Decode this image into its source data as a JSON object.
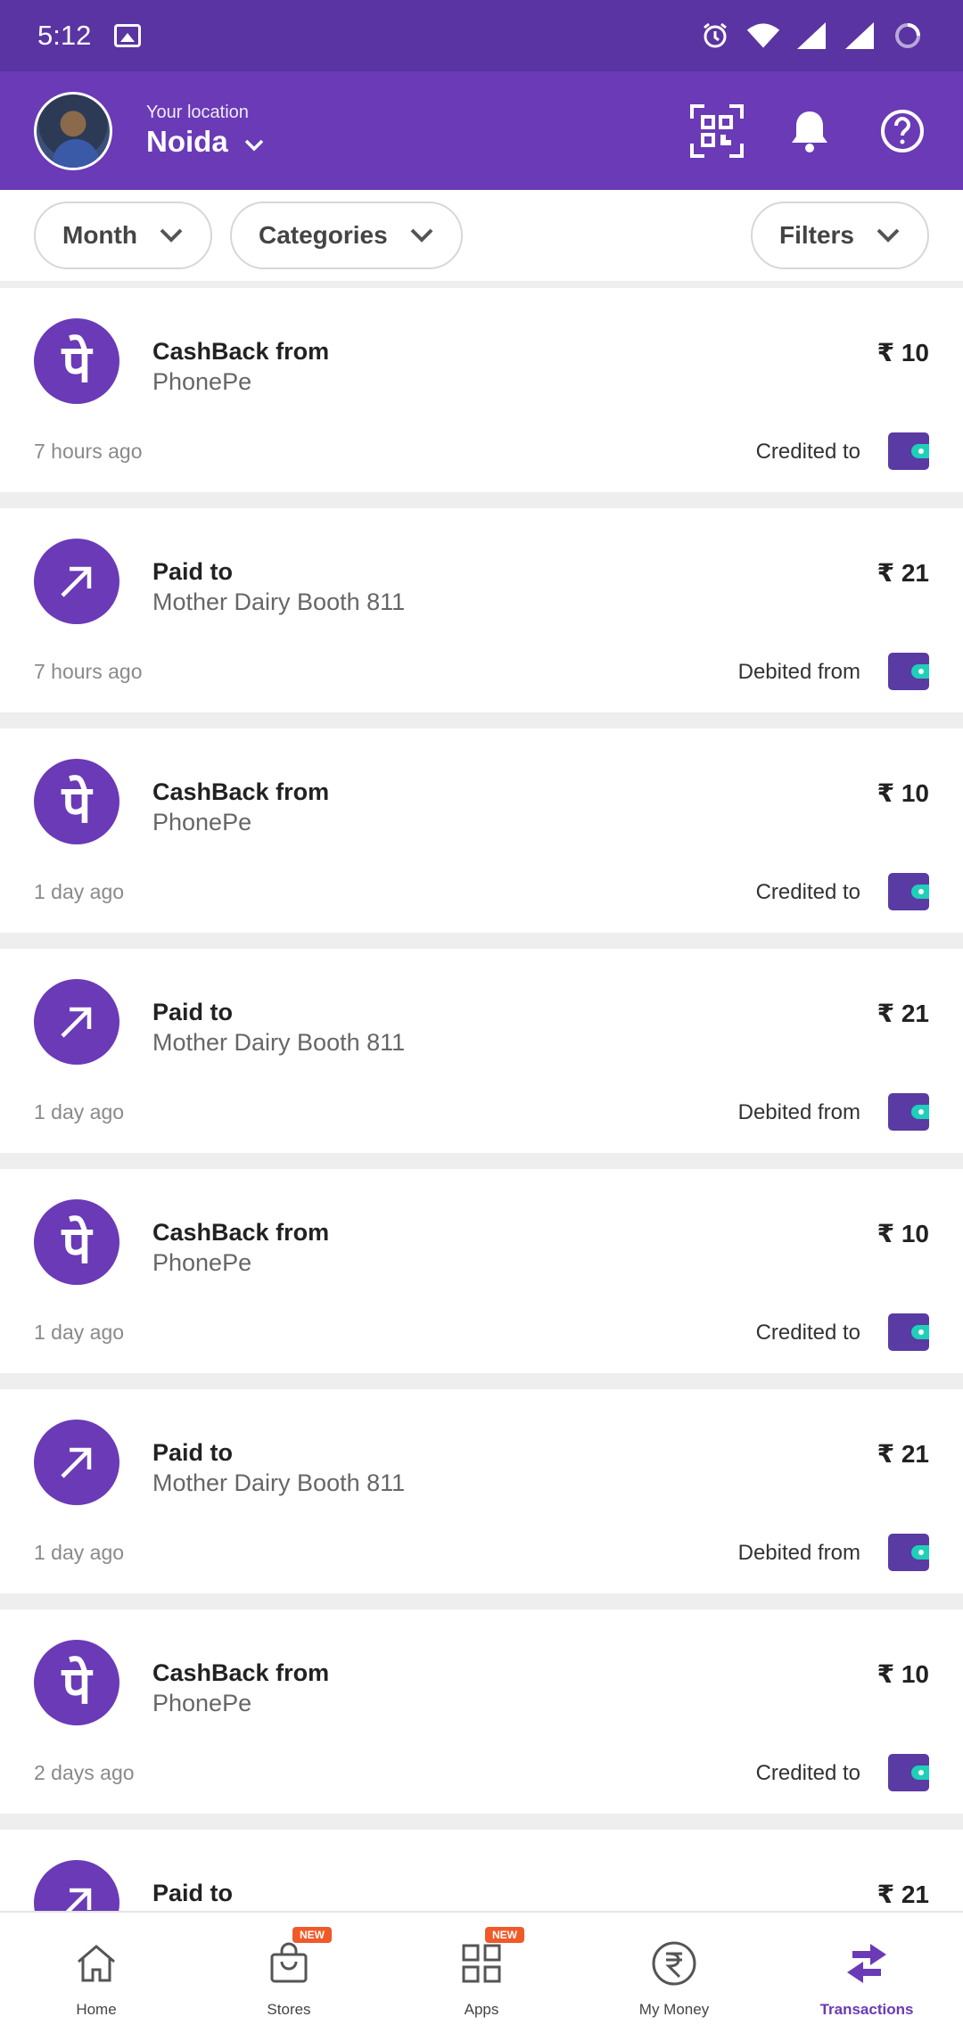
{
  "status_bar": {
    "time": "5:12",
    "icons": [
      "image-icon",
      "alarm-icon",
      "wifi-icon",
      "signal-icon",
      "signal-icon",
      "battery-icon"
    ]
  },
  "header": {
    "location_label": "Your location",
    "city": "Noida",
    "icons": [
      "qr-code-icon",
      "bell-icon",
      "help-icon"
    ],
    "background_color": "#6a3ab7"
  },
  "filters": {
    "month": "Month",
    "categories": "Categories",
    "filters": "Filters"
  },
  "transactions": [
    {
      "type": "cashback",
      "title": "CashBack from",
      "subtitle": "PhonePe",
      "amount": "₹ 10",
      "time": "7 hours ago",
      "status": "Credited to"
    },
    {
      "type": "paid",
      "title": "Paid to",
      "subtitle": "Mother Dairy Booth 811",
      "amount": "₹ 21",
      "time": "7 hours ago",
      "status": "Debited from"
    },
    {
      "type": "cashback",
      "title": "CashBack from",
      "subtitle": "PhonePe",
      "amount": "₹ 10",
      "time": "1 day ago",
      "status": "Credited to"
    },
    {
      "type": "paid",
      "title": "Paid to",
      "subtitle": "Mother Dairy Booth 811",
      "amount": "₹ 21",
      "time": "1 day ago",
      "status": "Debited from"
    },
    {
      "type": "cashback",
      "title": "CashBack from",
      "subtitle": "PhonePe",
      "amount": "₹ 10",
      "time": "1 day ago",
      "status": "Credited to"
    },
    {
      "type": "paid",
      "title": "Paid to",
      "subtitle": "Mother Dairy Booth 811",
      "amount": "₹ 21",
      "time": "1 day ago",
      "status": "Debited from"
    },
    {
      "type": "cashback",
      "title": "CashBack from",
      "subtitle": "PhonePe",
      "amount": "₹ 10",
      "time": "2 days ago",
      "status": "Credited to"
    },
    {
      "type": "paid",
      "title": "Paid to",
      "subtitle": "",
      "amount": "₹ 21",
      "time": "",
      "status": ""
    }
  ],
  "bottom_nav": {
    "items": [
      {
        "label": "Home",
        "icon": "home-icon",
        "badge": ""
      },
      {
        "label": "Stores",
        "icon": "shopping-bag-icon",
        "badge": "NEW"
      },
      {
        "label": "Apps",
        "icon": "apps-grid-icon",
        "badge": "NEW"
      },
      {
        "label": "My Money",
        "icon": "rupee-icon",
        "badge": ""
      },
      {
        "label": "Transactions",
        "icon": "transfer-arrows-icon",
        "badge": "",
        "active": true
      }
    ]
  },
  "colors": {
    "brand": "#6a3ab7",
    "status_bar": "#5a34a2",
    "wallet_accent": "#1ed0b8",
    "badge": "#f05a28"
  }
}
